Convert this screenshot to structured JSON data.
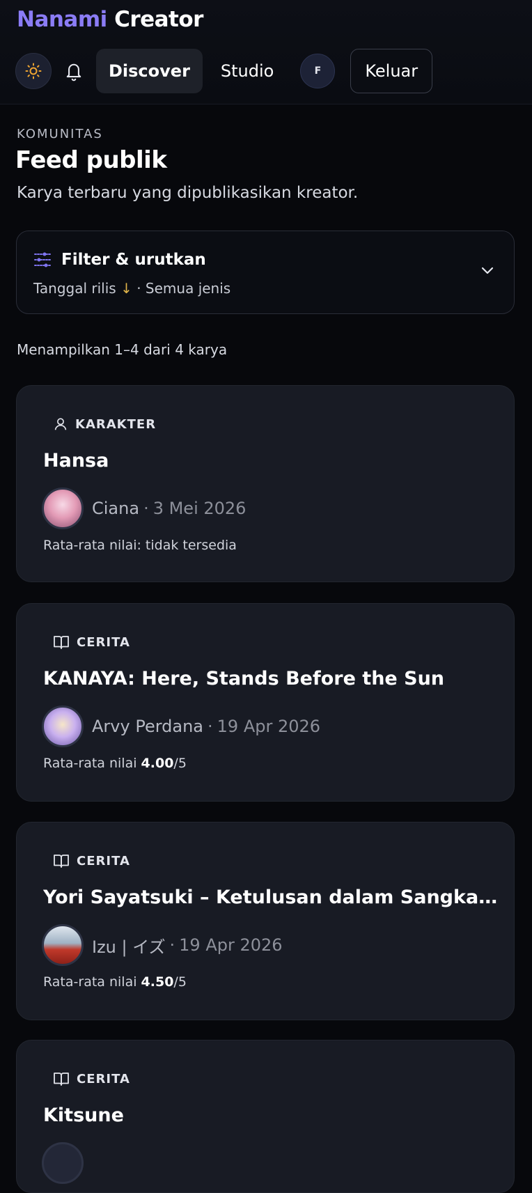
{
  "brand": {
    "first": "Nanami",
    "second": "Creator"
  },
  "nav": {
    "theme_icon": "sun-icon",
    "bell_icon": "bell-icon",
    "tabs": [
      {
        "label": "Discover",
        "active": true
      },
      {
        "label": "Studio",
        "active": false
      }
    ],
    "avatar_initial": "F",
    "logout_label": "Keluar"
  },
  "header": {
    "eyebrow": "KOMUNITAS",
    "title": "Feed publik",
    "subtitle": "Karya terbaru yang dipublikasikan kreator."
  },
  "filter": {
    "icon": "sliders-icon",
    "title": "Filter & urutkan",
    "sort_label": "Tanggal rilis",
    "sort_arrow": "↓",
    "separator": "·",
    "type_label": "Semua jenis",
    "chevron_icon": "chevron-down-icon"
  },
  "results": {
    "count_text": "Menampilkan 1–4 dari 4 karya"
  },
  "cards": [
    {
      "type": "KARAKTER",
      "type_icon": "user-icon",
      "title": "Hansa",
      "author": "Ciana",
      "date": "3 Mei 2026",
      "rating_prefix": "Rata-rata nilai: tidak tersedia",
      "rating_value": "",
      "rating_suffix": "",
      "avatar_color": "#e39bb6"
    },
    {
      "type": "CERITA",
      "type_icon": "book-icon",
      "title": "KANAYA: Here, Stands Before the Sun",
      "author": "Arvy Perdana",
      "date": "19 Apr 2026",
      "rating_prefix": "Rata-rata nilai ",
      "rating_value": "4.00",
      "rating_suffix": "/5",
      "avatar_color": "#b79be6"
    },
    {
      "type": "CERITA",
      "type_icon": "book-icon",
      "title": "Yori Sayatsuki – Ketulusan dalam Sangkar Ilusi",
      "author": "Izu | イズ",
      "date": "19 Apr 2026",
      "rating_prefix": "Rata-rata nilai ",
      "rating_value": "4.50",
      "rating_suffix": "/5",
      "avatar_color": "#c0392b"
    },
    {
      "type": "CERITA",
      "type_icon": "book-icon",
      "title": "Kitsune"
    }
  ]
}
